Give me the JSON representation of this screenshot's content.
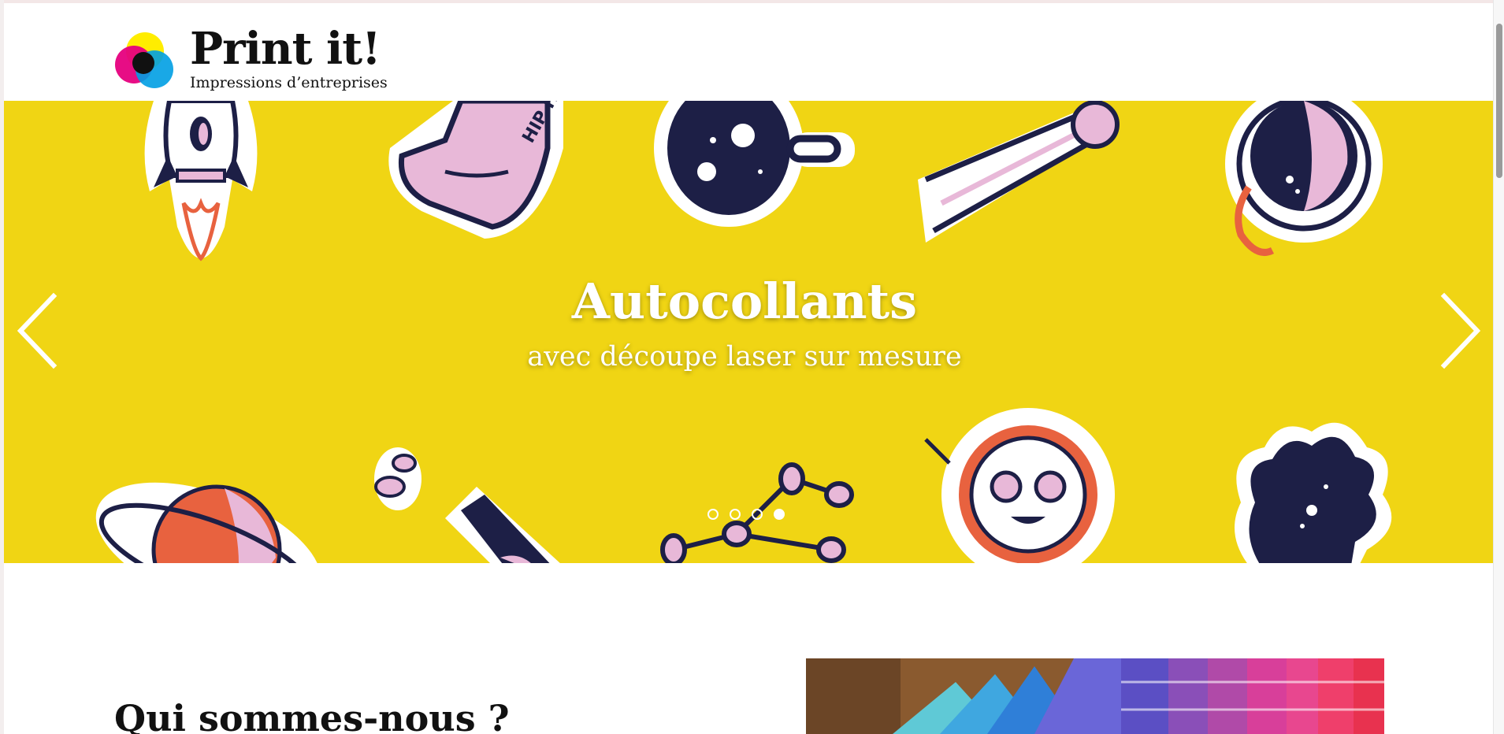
{
  "header": {
    "logo_title": "Print it!",
    "logo_subtitle": "Impressions d’entreprises",
    "logo_colors": [
      "#e6007e",
      "#ffed00",
      "#009fe3",
      "#111111"
    ]
  },
  "carousel": {
    "background_color": "#f0d514",
    "slide_title": "Autocollants",
    "slide_subtitle": "avec découpe laser sur mesure",
    "prev_icon": "chevron-left-icon",
    "next_icon": "chevron-right-icon",
    "slide_count": 4,
    "active_index": 3
  },
  "about": {
    "title": "Qui sommes-nous ?"
  },
  "colors": {
    "sticker_dark": "#1d1f46",
    "sticker_pink": "#e8b8d8",
    "sticker_orange": "#e8623f",
    "text_dark": "#111111"
  }
}
